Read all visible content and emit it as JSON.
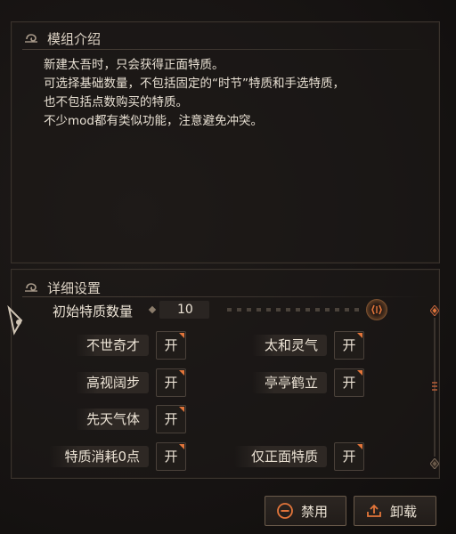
{
  "intro": {
    "title": "模组介绍",
    "lines": [
      "新建太吾时，只会获得正面特质。",
      "可选择基础数量，不包括固定的“时节”特质和手选特质，",
      "也不包括点数购买的特质。",
      "不少mod都有类似功能，注意避免冲突。"
    ]
  },
  "settings": {
    "title": "详细设置",
    "count_label": "初始特质数量",
    "count_value": "10",
    "options": [
      {
        "label": "不世奇才",
        "state": "开"
      },
      {
        "label": "太和灵气",
        "state": "开"
      },
      {
        "label": "高视阔步",
        "state": "开"
      },
      {
        "label": "亭亭鹤立",
        "state": "开"
      },
      {
        "label": "先天气体",
        "state": "开"
      },
      {
        "label": "特质消耗0点",
        "state": "开"
      },
      {
        "label": "仅正面特质",
        "state": "开"
      }
    ]
  },
  "buttons": {
    "disable": "禁用",
    "unload": "卸载"
  },
  "colors": {
    "accent": "#e2753a",
    "panel_border": "#3a332d"
  }
}
